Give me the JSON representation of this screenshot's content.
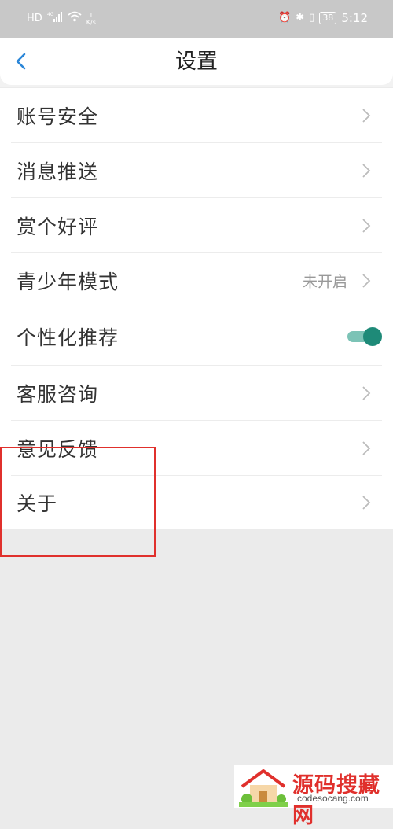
{
  "status_bar": {
    "carrier_badge": "HD",
    "network_gen": "4G",
    "net_speed_value": "1",
    "net_speed_unit": "K/s",
    "battery": "38",
    "time": "5:12"
  },
  "header": {
    "title": "设置",
    "back_icon": "chevron-left-icon"
  },
  "settings": {
    "items": [
      {
        "label": "账号安全"
      },
      {
        "label": "消息推送"
      },
      {
        "label": "赏个好评"
      },
      {
        "label": "青少年模式",
        "value": "未开启"
      },
      {
        "label": "个性化推荐",
        "toggle_on": true
      },
      {
        "label": "客服咨询"
      },
      {
        "label": "意见反馈"
      },
      {
        "label": "关于"
      }
    ]
  },
  "watermark": {
    "name": "源码搜藏网",
    "url": "codesocang.com"
  },
  "colors": {
    "accent": "#1e8a78",
    "back_arrow": "#2a86d8",
    "highlight": "#e0302c"
  }
}
